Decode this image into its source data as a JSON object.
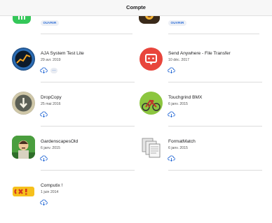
{
  "window": {
    "title": "Compte"
  },
  "top_row": [
    {
      "open_label": "OUVRIR"
    },
    {
      "open_label": "OUVRIR"
    }
  ],
  "apps": [
    {
      "name": "AJA System Test Lite",
      "date": "29 avr. 2019",
      "more": "…",
      "icon": "aja-gauge-icon"
    },
    {
      "name": "Send Anywhere - File Transfer",
      "date": "10 déc. 2017",
      "icon": "send-anywhere-icon"
    },
    {
      "name": "DropCopy",
      "date": "25 mai 2016",
      "icon": "dropcopy-icon"
    },
    {
      "name": "Touchgrind BMX",
      "date": "6 janv. 2015",
      "icon": "bmx-bike-icon"
    },
    {
      "name": "GardenscapesOld",
      "date": "6 janv. 2015",
      "icon": "gardener-icon"
    },
    {
      "name": "FormatMatch",
      "date": "6 janv. 2015",
      "icon": "documents-icon"
    },
    {
      "name": "Computix !",
      "date": "1 juin 2014",
      "icon": "computix-logo-icon"
    }
  ],
  "colors": {
    "accent": "#2a6cd6",
    "separator": "#dcdcdc"
  }
}
